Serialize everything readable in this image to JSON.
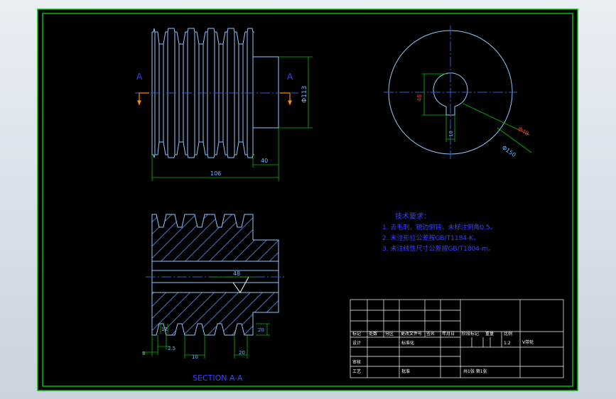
{
  "colors": {
    "background": "#000000",
    "frame": "#00c000",
    "outline": "#8ec8ff",
    "dimension": "#6ab6ff",
    "center_line": "#2a5fd0",
    "hatch": "#4a78c0",
    "technical_text": "#3a40ff",
    "red_mark": "#ff3030",
    "section_arrow": "#ff8a00",
    "title_block": "#ffffff"
  },
  "views": {
    "front": {
      "section_marks": [
        "A",
        "A"
      ],
      "dim_diameter": "Φ113",
      "dim_overall_length": "106",
      "dim_hub_length": "40"
    },
    "side": {
      "dim_keyway_height": "48",
      "dim_keyway_width": "10",
      "dim_hub_diameter": "Φ48",
      "dim_outer_diameter": "Φ150"
    },
    "section": {
      "title": "SECTION A-A",
      "dim_bore": "48",
      "dim_step": "20",
      "dim_groove_depth": "12",
      "dim_edge": "8",
      "dim_groove_pitch": "10",
      "dim_end_width": "20",
      "dim_taper": "2.5"
    }
  },
  "notes": {
    "title": "技术要求：",
    "items": [
      "1. 去毛刺，锐边倒钝，未标注倒角0.5。",
      "2. 未注形位公差按GB/T1184-K。",
      "3. 未注线性尺寸公差按GB/T1804-m。"
    ]
  },
  "title_block": {
    "header_labels": [
      "标记",
      "处数",
      "分区",
      "更改文件号",
      "签名",
      "年月日",
      "阶段标记",
      "重量",
      "比例"
    ],
    "row_design": [
      "设计",
      "标准化"
    ],
    "row_review": "审核",
    "row_process": [
      "工艺",
      "批准"
    ],
    "sheet_info": "共1张 第1张",
    "scale_value": "1:2",
    "drawing_name": "V带轮"
  }
}
